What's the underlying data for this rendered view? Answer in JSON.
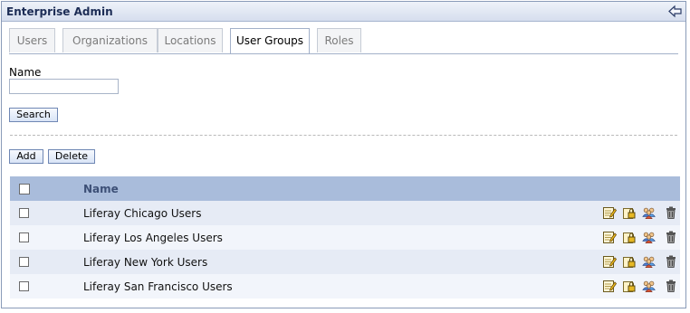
{
  "portlet": {
    "title": "Enterprise Admin",
    "back_icon": "back-arrow-icon"
  },
  "tabs": [
    {
      "label": "Users",
      "active": false
    },
    {
      "label": "Organizations",
      "active": false
    },
    {
      "label": "Locations",
      "active": false
    },
    {
      "label": "User Groups",
      "active": true
    },
    {
      "label": "Roles",
      "active": false
    }
  ],
  "search": {
    "name_label": "Name",
    "name_value": "",
    "search_button": "Search"
  },
  "actions": {
    "add_button": "Add",
    "delete_button": "Delete"
  },
  "table": {
    "header": {
      "name": "Name"
    },
    "rows": [
      {
        "name": "Liferay Chicago Users",
        "checked": false
      },
      {
        "name": "Liferay Los Angeles Users",
        "checked": false
      },
      {
        "name": "Liferay New York Users",
        "checked": false
      },
      {
        "name": "Liferay San Francisco Users",
        "checked": false
      }
    ],
    "row_action_icons": [
      "edit-icon",
      "permissions-icon",
      "assign-members-icon",
      "delete-icon"
    ]
  }
}
